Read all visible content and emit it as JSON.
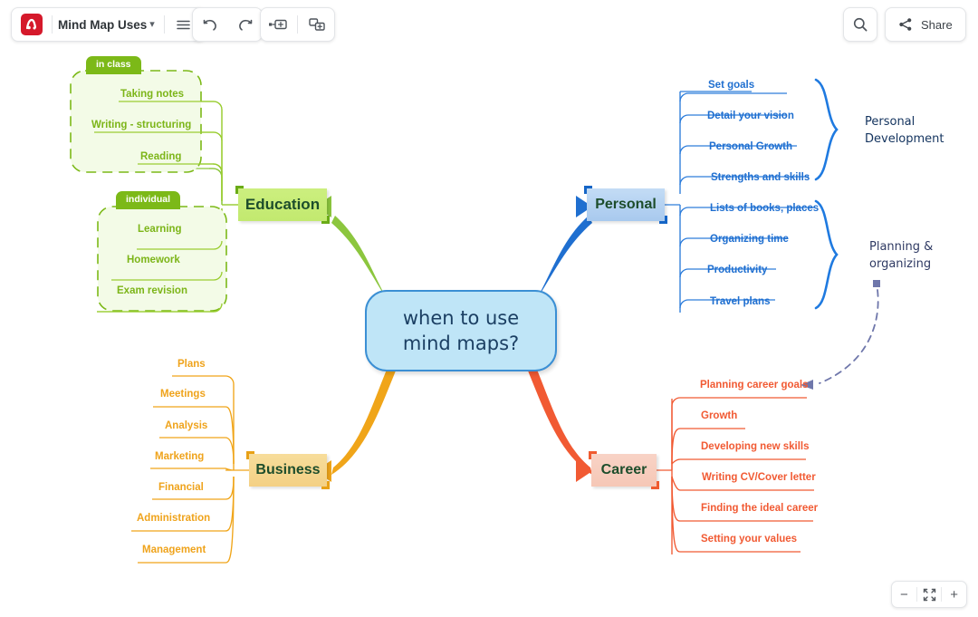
{
  "toolbar": {
    "logo_name": "mindomo-logo",
    "doc_title": "Mind Map Uses",
    "menu_icon": "hamburger-menu-icon",
    "undo_icon": "undo-arrow-icon",
    "redo_icon": "redo-arrow-icon",
    "add_sibling_icon": "add-sibling-topic-icon",
    "add_subtopic_icon": "add-subtopic-icon",
    "search_icon": "search-icon",
    "share_icon": "share-icon",
    "share_label": "Share"
  },
  "zoom_controls": {
    "zoom_out_label": "−",
    "fit_label": "fit-to-screen-icon",
    "zoom_in_label": "+"
  },
  "mindmap": {
    "center": {
      "line1": "when to use",
      "line2": "mind maps?"
    },
    "branches": [
      {
        "id": "education",
        "label": "Education",
        "color": "#8cc63e",
        "groups": [
          {
            "badge": "in class",
            "items": [
              "Taking notes",
              "Writing - structuring",
              "Reading"
            ]
          },
          {
            "badge": "individual",
            "items": [
              "Learning",
              "Homework",
              "Exam revision"
            ]
          }
        ]
      },
      {
        "id": "personal",
        "label": "Personal",
        "color": "#1f6fd0",
        "items": [
          "Set goals",
          "Detail your vision",
          "Personal Growth",
          "Strengths and skills",
          "Lists of books, places",
          "Organizing time",
          "Productivity",
          "Travel plans"
        ],
        "boundaries": [
          {
            "label_line1": "Personal",
            "label_line2": "Development"
          },
          {
            "label_line1": "Planning &",
            "label_line2": "organizing"
          }
        ]
      },
      {
        "id": "business",
        "label": "Business",
        "color": "#f0a519",
        "items": [
          "Plans",
          "Meetings",
          "Analysis",
          "Marketing",
          "Financial",
          "Administration",
          "Management"
        ]
      },
      {
        "id": "career",
        "label": "Career",
        "color": "#f15a33",
        "items": [
          "Planning career goals",
          "Growth",
          "Developing new skills",
          "Writing CV/Cover letter",
          "Finding the ideal career",
          "Setting  your values"
        ]
      }
    ],
    "cross_link": {
      "from": "Planning & organizing",
      "to": "Planning career goals",
      "style": "dashed",
      "color": "#6f77ab"
    }
  }
}
